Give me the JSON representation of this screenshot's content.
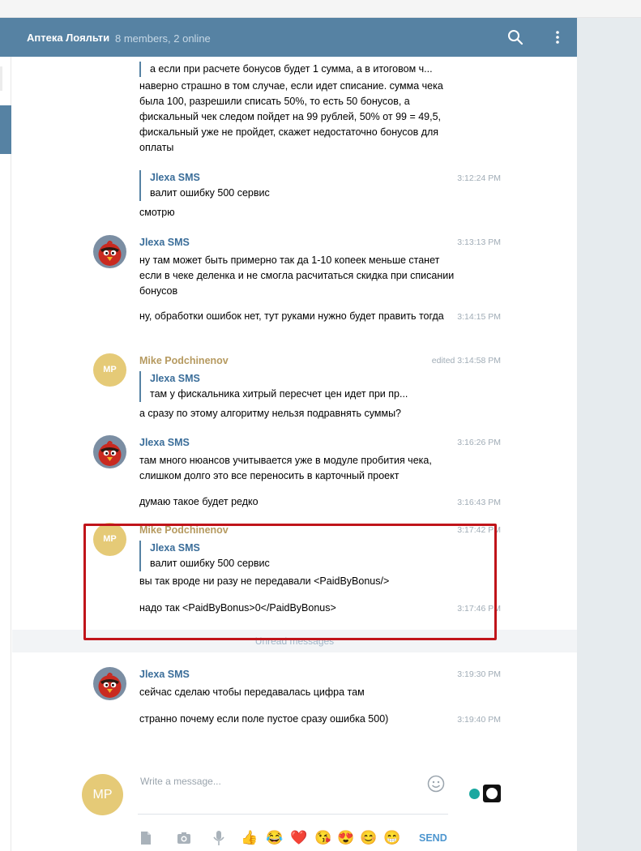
{
  "header": {
    "title": "Аптека Лояльти",
    "subtitle": "8 members, 2 online"
  },
  "messages": [
    {
      "quote_text": "а если при расчете бонусов будет 1 сумма, а в итоговом ч..."
    },
    {
      "text": "наверно страшно в том случае, если идет списание. сумма чека была 100, разрешили списать 50%, то есть 50 бонусов, а фискальный чек следом пойдет на 99 рублей, 50% от 99 = 49,5, фискальный уже не пройдет, скажет недостаточно бонусов для оплаты"
    },
    {
      "quote_name": "Jlexa SMS",
      "quote_text": "валит ошибку 500 сервис",
      "time": "3:12:24 PM",
      "text": "смотрю"
    },
    {
      "name": "Jlexa SMS",
      "time": "3:13:13 PM",
      "text": "ну там может быть примерно так да 1-10 копеек меньше станет если в чеке деленка и не смогла расчитаться скидка при списании бонусов"
    },
    {
      "time": "3:14:15 PM",
      "text": "ну, обработки ошибок нет, тут руками нужно будет править тогда"
    },
    {
      "avatar": "MP",
      "name": "Mike Podchinenov",
      "time": "edited 3:14:58 PM",
      "quote_name": "Jlexa SMS",
      "quote_text": "там у фискальника хитрый пересчет цен идет при пр...",
      "text": "а сразу по этому алгоритму нельзя подравнять суммы?"
    },
    {
      "name": "Jlexa SMS",
      "time": "3:16:26 PM",
      "text": "там много нюансов учитывается уже в модуле пробития чека, слишком долго это все переносить в карточный проект"
    },
    {
      "time": "3:16:43 PM",
      "text": "думаю такое будет редко"
    },
    {
      "avatar": "MP",
      "name": "Mike Podchinenov",
      "time": "3:17:42 PM",
      "quote_name": "Jlexa SMS",
      "quote_text": "валит ошибку 500 сервис",
      "text": "вы так вроде ни разу не передавали <PaidByBonus/>"
    },
    {
      "time": "3:17:46 PM",
      "text": "надо так <PaidByBonus>0</PaidByBonus>"
    },
    {
      "name": "Jlexa SMS",
      "time": "3:19:30 PM",
      "text": "сейчас сделаю чтобы передавалась цифра там"
    },
    {
      "time": "3:19:40 PM",
      "text": "странно почему если  поле пустое сразу ошибка 500)"
    }
  ],
  "unread_label": "Unread messages",
  "composer": {
    "avatar": "MP",
    "placeholder": "Write a message...",
    "send_label": "SEND"
  },
  "toolbar_icons": [
    "file-icon",
    "camera-icon",
    "microphone-icon",
    "thumbs-up-emoji",
    "tears-of-joy-emoji",
    "heart-emoji",
    "kiss-emoji",
    "heart-eyes-emoji",
    "smile-emoji",
    "grimace-emoji"
  ],
  "toolbar_glyphs": [
    "👍",
    "😂",
    "❤️",
    "😘",
    "😍",
    "😊",
    "😁"
  ],
  "colors": {
    "header_bg": "#5682a3",
    "name_blue": "#3a6d99",
    "name_gold": "#b69a60",
    "avatar_mp": "#e5ca77",
    "highlight": "#c0141a",
    "send": "#4d96cf"
  }
}
